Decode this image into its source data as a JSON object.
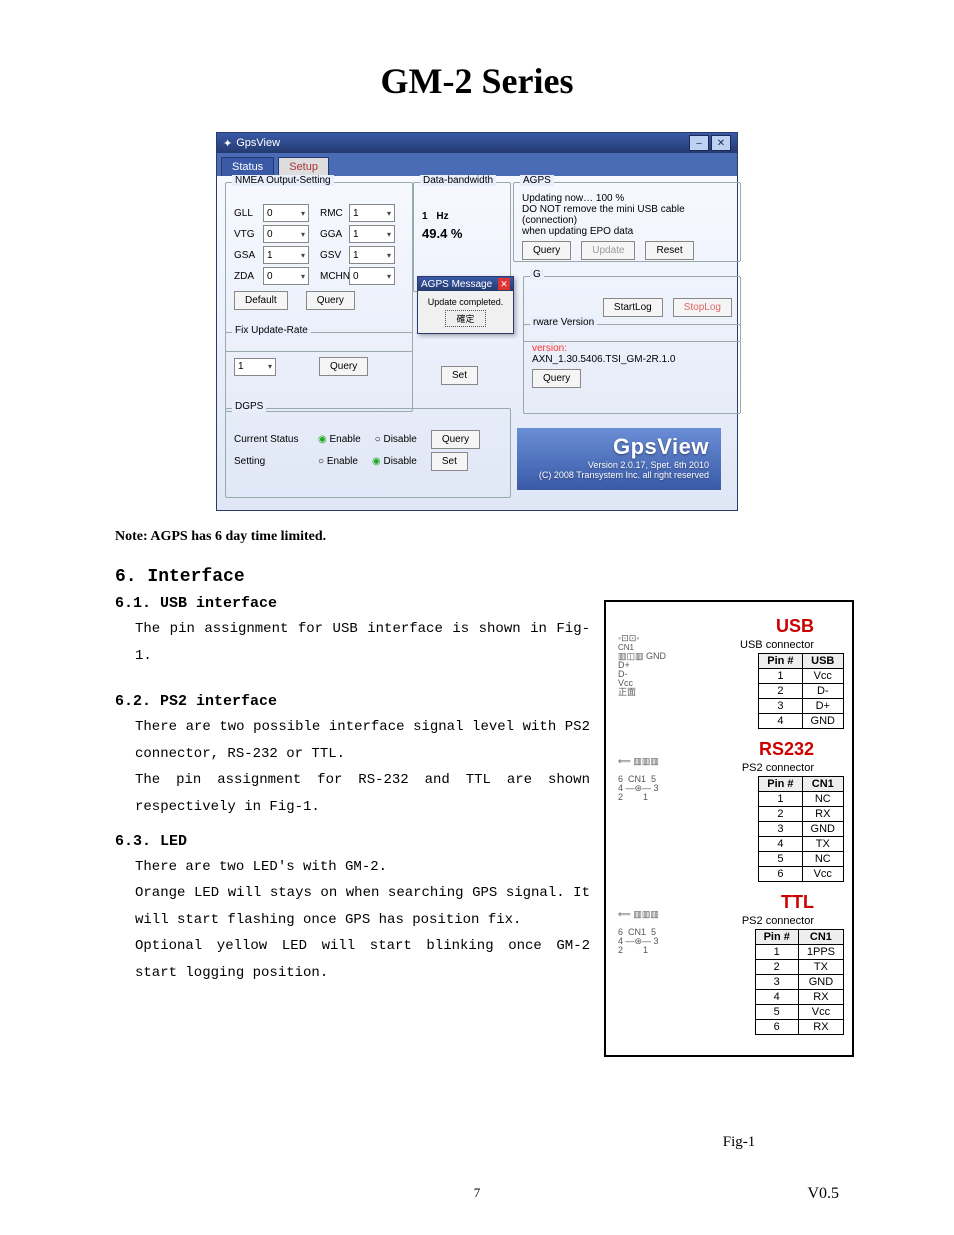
{
  "page": {
    "title": "GM-2 Series",
    "note": "Note: AGPS has 6 day time limited.",
    "page_number": "7",
    "version": "V0.5",
    "fig_caption": "Fig-1"
  },
  "screenshot": {
    "window_title": "GpsView",
    "tabs": {
      "status": "Status",
      "setup": "Setup"
    },
    "nmea": {
      "legend": "NMEA Output-Setting",
      "fields": {
        "gll": {
          "label": "GLL",
          "value": "0"
        },
        "rmc": {
          "label": "RMC",
          "value": "1"
        },
        "vtg": {
          "label": "VTG",
          "value": "0"
        },
        "gga": {
          "label": "GGA",
          "value": "1"
        },
        "gsa": {
          "label": "GSA",
          "value": "1"
        },
        "gsv": {
          "label": "GSV",
          "value": "1"
        },
        "zda": {
          "label": "ZDA",
          "value": "0"
        },
        "mchn": {
          "label": "MCHN",
          "value": "0"
        }
      },
      "default_btn": "Default",
      "query_btn": "Query"
    },
    "databw": {
      "legend": "Data-bandwidth",
      "hz_label": "Hz",
      "hz_value": "1",
      "pct": "49.4 %"
    },
    "fixrate": {
      "legend": "Fix Update-Rate",
      "value": "1",
      "query_btn": "Query",
      "set_btn": "Set"
    },
    "agps": {
      "legend": "AGPS",
      "status1": "Updating now… 100 %",
      "status2": "DO NOT remove the mini USB cable (connection)",
      "status3": "when updating EPO data",
      "query_btn": "Query",
      "update_btn": "Update",
      "reset_btn": "Reset"
    },
    "agps_msg": {
      "title": "AGPS Message",
      "text": "Update completed.",
      "ok": "確定"
    },
    "glog": {
      "legend": "G",
      "start": "StartLog",
      "stop": "StopLog"
    },
    "fw": {
      "legend": "rware Version",
      "sublabel": "version:",
      "value": "AXN_1.30.5406.TSI_GM-2R.1.0",
      "query_btn": "Query"
    },
    "dgps": {
      "legend": "DGPS",
      "current_label": "Current Status",
      "setting_label": "Setting",
      "enable": "Enable",
      "disable": "Disable",
      "query_btn": "Query",
      "set_btn": "Set"
    },
    "banner": {
      "title": "GpsView",
      "line1": "Version 2.0.17, Spet. 6th 2010",
      "line2": "(C) 2008 Transystem Inc. all right reserved"
    }
  },
  "sections": {
    "s6": {
      "heading": "6. Interface"
    },
    "s61": {
      "heading": "6.1.  USB interface",
      "text": "The pin assignment for USB interface is shown in Fig-1."
    },
    "s62": {
      "heading": "6.2.  PS2 interface",
      "text1": "There are two possible interface signal level with PS2 connector, RS-232 or TTL.",
      "text2": "The pin assignment for RS-232 and TTL are shown respectively in Fig-1."
    },
    "s63": {
      "heading": "6.3.  LED",
      "text1": "There are two LED's with GM-2.",
      "text2": "Orange LED will stays on when searching GPS signal. It will start flashing once GPS has position fix.",
      "text3": "Optional yellow LED will start blinking once GM-2 start logging position."
    }
  },
  "pin": {
    "usb": {
      "heading": "USB",
      "connector": "USB connector",
      "side_labels": "GND\nD+\nD-\nVcc",
      "cols": [
        "Pin #",
        "USB"
      ],
      "rows": [
        [
          "1",
          "Vcc"
        ],
        [
          "2",
          "D-"
        ],
        [
          "3",
          "D+"
        ],
        [
          "4",
          "GND"
        ]
      ]
    },
    "rs232": {
      "heading": "RS232",
      "connector": "PS2 connector",
      "cols": [
        "Pin #",
        "CN1"
      ],
      "rows": [
        [
          "1",
          "NC"
        ],
        [
          "2",
          "RX"
        ],
        [
          "3",
          "GND"
        ],
        [
          "4",
          "TX"
        ],
        [
          "5",
          "NC"
        ],
        [
          "6",
          "Vcc"
        ]
      ]
    },
    "ttl": {
      "heading": "TTL",
      "connector": "PS2 connector",
      "cols": [
        "Pin #",
        "CN1"
      ],
      "rows": [
        [
          "1",
          "1PPS"
        ],
        [
          "2",
          "TX"
        ],
        [
          "3",
          "GND"
        ],
        [
          "4",
          "RX"
        ],
        [
          "5",
          "Vcc"
        ],
        [
          "6",
          "RX"
        ]
      ]
    }
  }
}
